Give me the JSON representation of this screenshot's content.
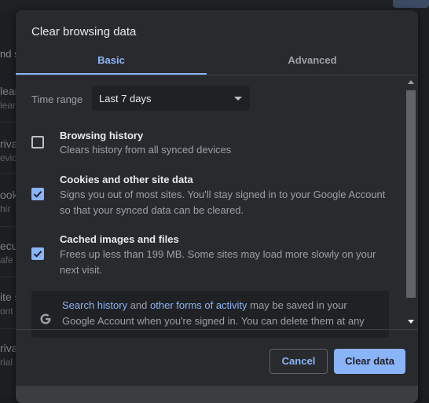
{
  "background": {
    "left_fragments": [
      "nd s",
      "lear",
      "lear",
      "riva",
      "evic",
      "ook",
      "hir",
      "ecu",
      "afe",
      "ite s",
      "ont",
      "riva",
      "rial"
    ]
  },
  "dialog": {
    "title": "Clear browsing data",
    "tabs": [
      {
        "label": "Basic",
        "selected": true
      },
      {
        "label": "Advanced",
        "selected": false
      }
    ],
    "time_range": {
      "label": "Time range",
      "value": "Last 7 days"
    },
    "options": [
      {
        "title": "Browsing history",
        "desc": "Clears history from all synced devices",
        "checked": false
      },
      {
        "title": "Cookies and other site data",
        "desc": "Signs you out of most sites. You'll stay signed in to your Google Account so that your synced data can be cleared.",
        "checked": true
      },
      {
        "title": "Cached images and files",
        "desc": "Frees up less than 199 MB. Some sites may load more slowly on your next visit.",
        "checked": true
      }
    ],
    "info": {
      "link1": "Search history",
      "text1": " and ",
      "link2": "other forms of activity",
      "text2": " may be saved in your Google Account when you're signed in. You can delete them at any"
    },
    "buttons": {
      "cancel": "Cancel",
      "clear": "Clear data"
    }
  },
  "colors": {
    "accent": "#8ab4f8",
    "dialog_bg": "#292a2d",
    "text_primary": "#e8eaed",
    "text_secondary": "#9aa0a6"
  },
  "icons": {
    "google": "google-g-icon",
    "caret": "dropdown-caret-icon",
    "check": "checkmark-icon"
  }
}
